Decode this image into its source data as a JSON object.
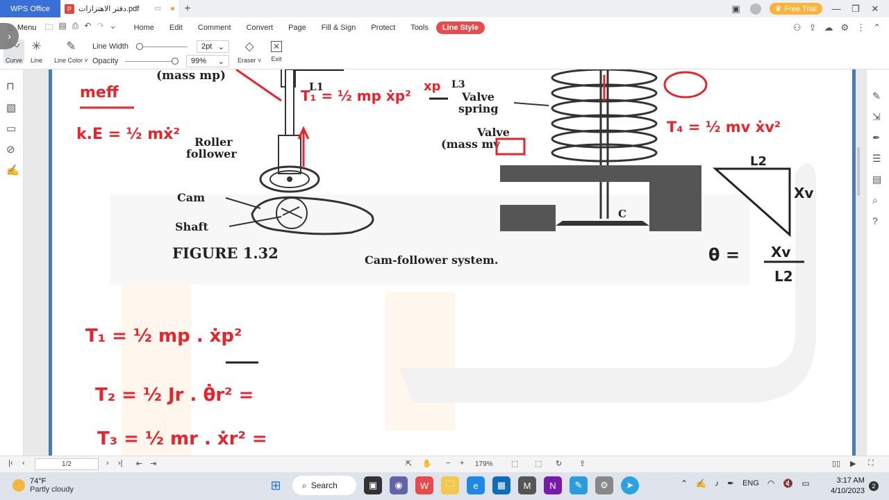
{
  "titlebar": {
    "app_tab": "WPS Office",
    "doc_tab": "دفتر الاهتزازات.pdf",
    "free_trial": "Free Trial"
  },
  "ribbon": {
    "menu_label": "Menu",
    "tabs": [
      "Home",
      "Edit",
      "Comment",
      "Convert",
      "Page",
      "Fill & Sign",
      "Protect",
      "Tools",
      "Line Style"
    ],
    "active_tab": "Line Style"
  },
  "toolbar": {
    "curve": "Curve",
    "line": "Line",
    "line_color": "Line Color",
    "line_width_label": "Line Width",
    "line_width_value": "2pt",
    "opacity_label": "Opacity",
    "opacity_value": "99%",
    "eraser": "Eraser",
    "exit": "Exit"
  },
  "document": {
    "scan": {
      "mass_mp": "(mass mp)",
      "roller_follower_1": "Roller",
      "roller_follower_2": "follower",
      "cam": "Cam",
      "shaft": "Shaft",
      "figure_label": "FIGURE 1.32",
      "figure_caption": "Cam-follower system.",
      "valve_spring_1": "Valve",
      "valve_spring_2": "spring",
      "valve_1": "Valve",
      "valve_2": "(mass mv",
      "point_c": "C",
      "l1": "L1",
      "l3": "L3"
    },
    "handwriting": {
      "meff": "meff",
      "ke": "k.E = ½ mẋ²",
      "t1_top": "T₁ = ½ mp ẋp²",
      "xp": "xp",
      "t4": "T₄ = ½ mv ẋv²",
      "xv_box": "xv",
      "l2": "L2",
      "xv": "Xv",
      "theta_eq_lhs": "θ =",
      "theta_num": "Xv",
      "theta_den": "L2",
      "t1": "T₁ = ½ mp . ẋp²",
      "t2": "T₂ = ½ Jr . θ̇r² =",
      "t3": "T₃ = ½ mr . ẋr² ="
    }
  },
  "statusbar": {
    "page": "1/2",
    "zoom": "179%"
  },
  "taskbar": {
    "temp": "74°F",
    "weather": "Partly cloudy",
    "search": "Search",
    "lang": "ENG",
    "time": "3:17 AM",
    "date": "4/10/2023",
    "notifications": "2"
  }
}
